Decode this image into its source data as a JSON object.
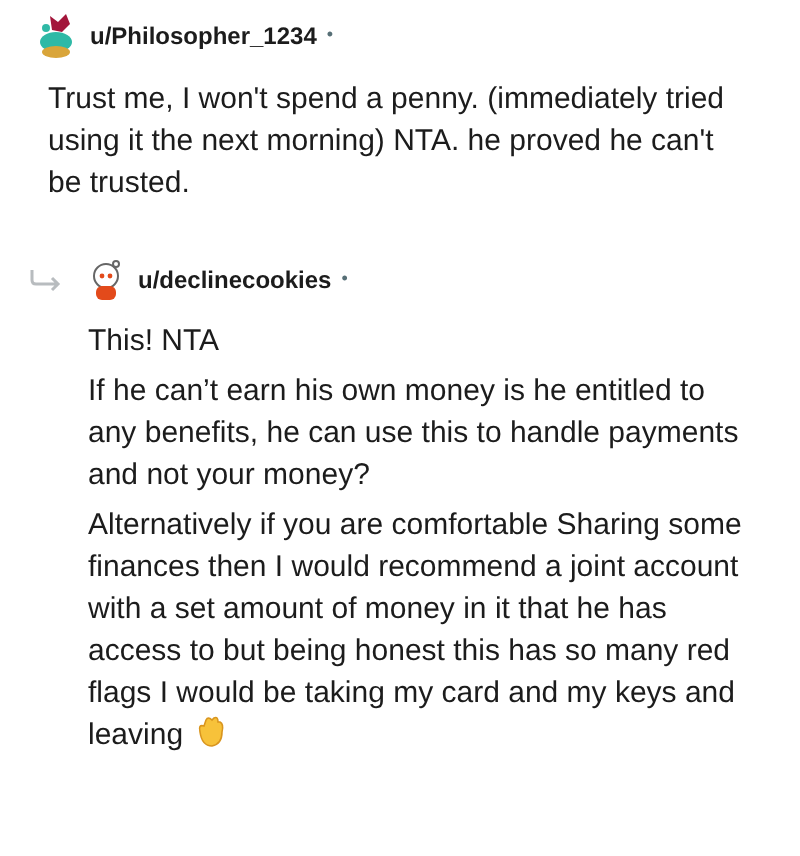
{
  "comments": [
    {
      "username": "u/Philosopher_1234",
      "separator": "•",
      "reply": false,
      "paragraphs": [
        "Trust me, I won't spend a penny. (immediately tried using it the next morning) NTA. he proved he can't be trusted."
      ],
      "ends_with_wave": false
    },
    {
      "username": "u/declinecookies",
      "separator": "•",
      "reply": true,
      "paragraphs": [
        "This! NTA",
        "If he can’t earn his own money is he entitled to any benefits, he can use this to handle payments and not your money?",
        "Alternatively if you are comfortable Sharing some finances then I would recommend a joint account with a set amount of money in it that he has access to but being honest this has so many red flags I would be taking my card and my keys and leaving"
      ],
      "ends_with_wave": true
    }
  ]
}
